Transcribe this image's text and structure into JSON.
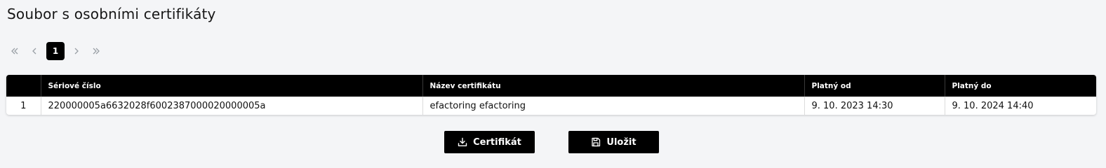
{
  "page": {
    "title": "Soubor s osobními certifikáty"
  },
  "pagination": {
    "current_page": "1",
    "icons": {
      "first": "double-chevron-left-icon",
      "prev": "chevron-left-icon",
      "next": "chevron-right-icon",
      "last": "double-chevron-right-icon"
    }
  },
  "table": {
    "columns": [
      "",
      "Sériové číslo",
      "Název certifikátu",
      "Platný od",
      "Platný do"
    ],
    "rows": [
      {
        "index": "1",
        "serial": "220000005a6632028f6002387000020000005a",
        "name": "efactoring efactoring",
        "valid_from": "9. 10. 2023 14:30",
        "valid_to": "9. 10. 2024 14:40"
      }
    ]
  },
  "actions": {
    "certificate_label": "Certifikát",
    "certificate_icon": "download-icon",
    "save_label": "Uložit",
    "save_icon": "floppy-disk-icon"
  },
  "colors": {
    "background": "#f4f5f7",
    "header": "#000000",
    "button": "#000000",
    "pager_disabled": "#9aa0a6"
  }
}
